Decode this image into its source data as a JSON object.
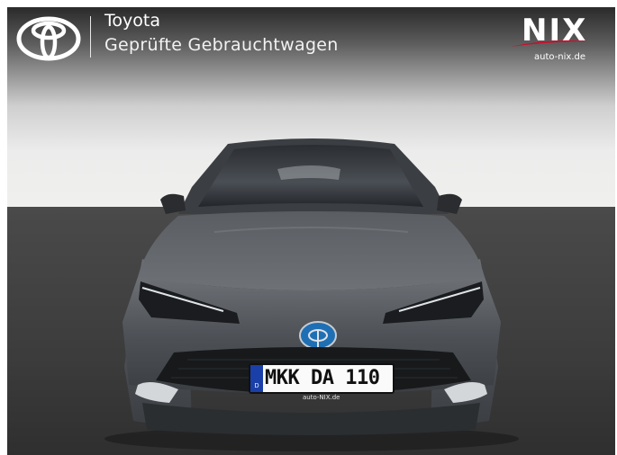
{
  "header": {
    "brand_name": "Toyota",
    "brand_subtitle": "Geprüfte Gebrauchtwagen",
    "brand_logo_icon": "toyota-emblem-icon"
  },
  "dealer": {
    "name": "NIX",
    "url": "auto-nix.de",
    "accent_color": "#c8102e"
  },
  "vehicle": {
    "plate_country": "D",
    "plate_text": "MKK DA 110",
    "plate_frame_text": "auto-NIX.de",
    "body_color": "#4a4d52"
  }
}
